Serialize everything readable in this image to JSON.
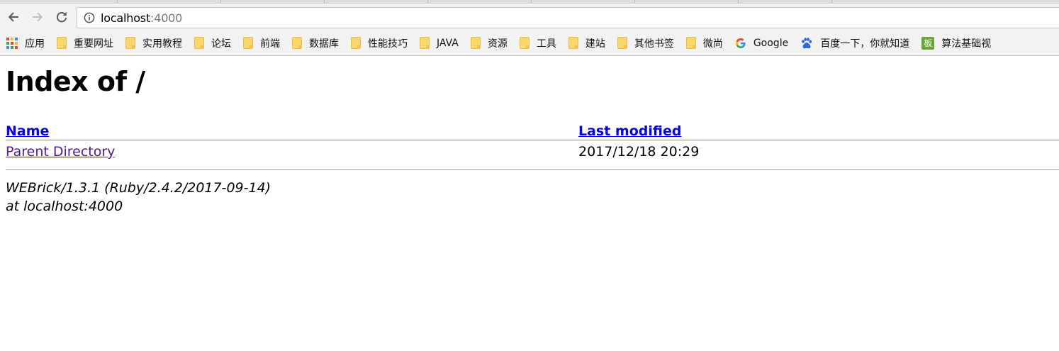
{
  "browser": {
    "url_host": "localhost",
    "url_port": ":4000",
    "bookmarks": [
      {
        "label": "应用",
        "icon": "apps-grid-icon"
      },
      {
        "label": "重要网址",
        "icon": "folder-icon"
      },
      {
        "label": "实用教程",
        "icon": "folder-icon"
      },
      {
        "label": "论坛",
        "icon": "folder-icon"
      },
      {
        "label": "前端",
        "icon": "folder-icon"
      },
      {
        "label": "数据库",
        "icon": "folder-icon"
      },
      {
        "label": "性能技巧",
        "icon": "folder-icon"
      },
      {
        "label": "JAVA",
        "icon": "folder-icon"
      },
      {
        "label": "资源",
        "icon": "folder-icon"
      },
      {
        "label": "工具",
        "icon": "folder-icon"
      },
      {
        "label": "建站",
        "icon": "folder-icon"
      },
      {
        "label": "其他书签",
        "icon": "folder-icon"
      },
      {
        "label": "微尚",
        "icon": "folder-icon"
      },
      {
        "label": "Google",
        "icon": "google-icon"
      },
      {
        "label": "百度一下，你就知道",
        "icon": "baidu-icon"
      },
      {
        "label": "算法基础视",
        "icon": "bookmark-ban-icon",
        "icon_text": "板"
      }
    ]
  },
  "page": {
    "title": "Index of /",
    "columns": {
      "name": "Name",
      "modified": "Last modified"
    },
    "rows": [
      {
        "name": "Parent Directory",
        "modified": "2017/12/18 20:29"
      }
    ],
    "footer_line1": "WEBrick/1.3.1 (Ruby/2.4.2/2017-09-14)",
    "footer_line2": "at localhost:4000"
  },
  "colors": {
    "link": "#0000ee",
    "visited_link": "#551a8b",
    "folder": "#fbd86d",
    "chrome_bg": "#f2f2f2"
  }
}
